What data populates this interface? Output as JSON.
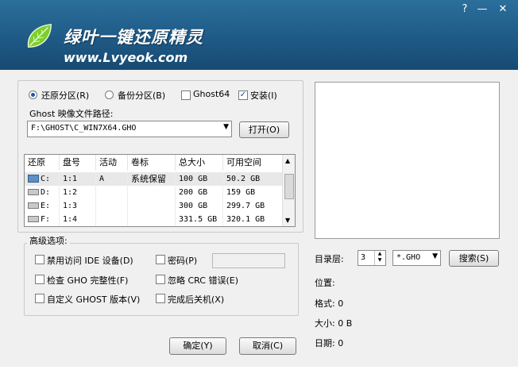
{
  "header": {
    "app_name": "绿叶一键还原精灵",
    "url": "www.Lvyeok.com",
    "help_label": "?",
    "minimize_label": "—",
    "close_label": "✕"
  },
  "options": {
    "restore_label": "还原分区(R)",
    "backup_label": "备份分区(B)",
    "ghost64_label": "Ghost64",
    "install_label": "安装(I)",
    "restore_selected": true,
    "ghost64_checked": false,
    "install_checked": true,
    "path_label": "Ghost 映像文件路径:",
    "path_value": "F:\\GHOST\\C_WIN7X64.GHO",
    "open_button": "打开(O)"
  },
  "table": {
    "headers": [
      "还原",
      "盘号",
      "活动",
      "卷标",
      "总大小",
      "可用空间"
    ],
    "rows": [
      {
        "drive": "C:",
        "num": "1:1",
        "active": "A",
        "label": "系统保留",
        "total": "100 GB",
        "free": "50.2 GB"
      },
      {
        "drive": "D:",
        "num": "1:2",
        "active": "",
        "label": "",
        "total": "200 GB",
        "free": "159 GB"
      },
      {
        "drive": "E:",
        "num": "1:3",
        "active": "",
        "label": "",
        "total": "300 GB",
        "free": "299.7 GB"
      },
      {
        "drive": "F:",
        "num": "1:4",
        "active": "",
        "label": "",
        "total": "331.5 GB",
        "free": "320.1 GB"
      }
    ]
  },
  "advanced": {
    "title": "高级选项:",
    "no_ide": "禁用访问 IDE 设备(D)",
    "password": "密码(P)",
    "check_gho": "检查 GHO 完整性(F)",
    "ignore_crc": "忽略 CRC 错误(E)",
    "custom_ghost": "自定义 GHOST 版本(V)",
    "shutdown": "完成后关机(X)"
  },
  "search": {
    "dir_level_label": "目录层:",
    "dir_level_value": "3",
    "ext_value": "*.GHO",
    "search_button": "搜索(S)"
  },
  "info": {
    "location": "位置:",
    "format": "格式: 0",
    "size": "大小: 0 B",
    "date": "日期: 0"
  },
  "footer": {
    "ok_button": "确定(Y)",
    "cancel_button": "取消(C)"
  }
}
